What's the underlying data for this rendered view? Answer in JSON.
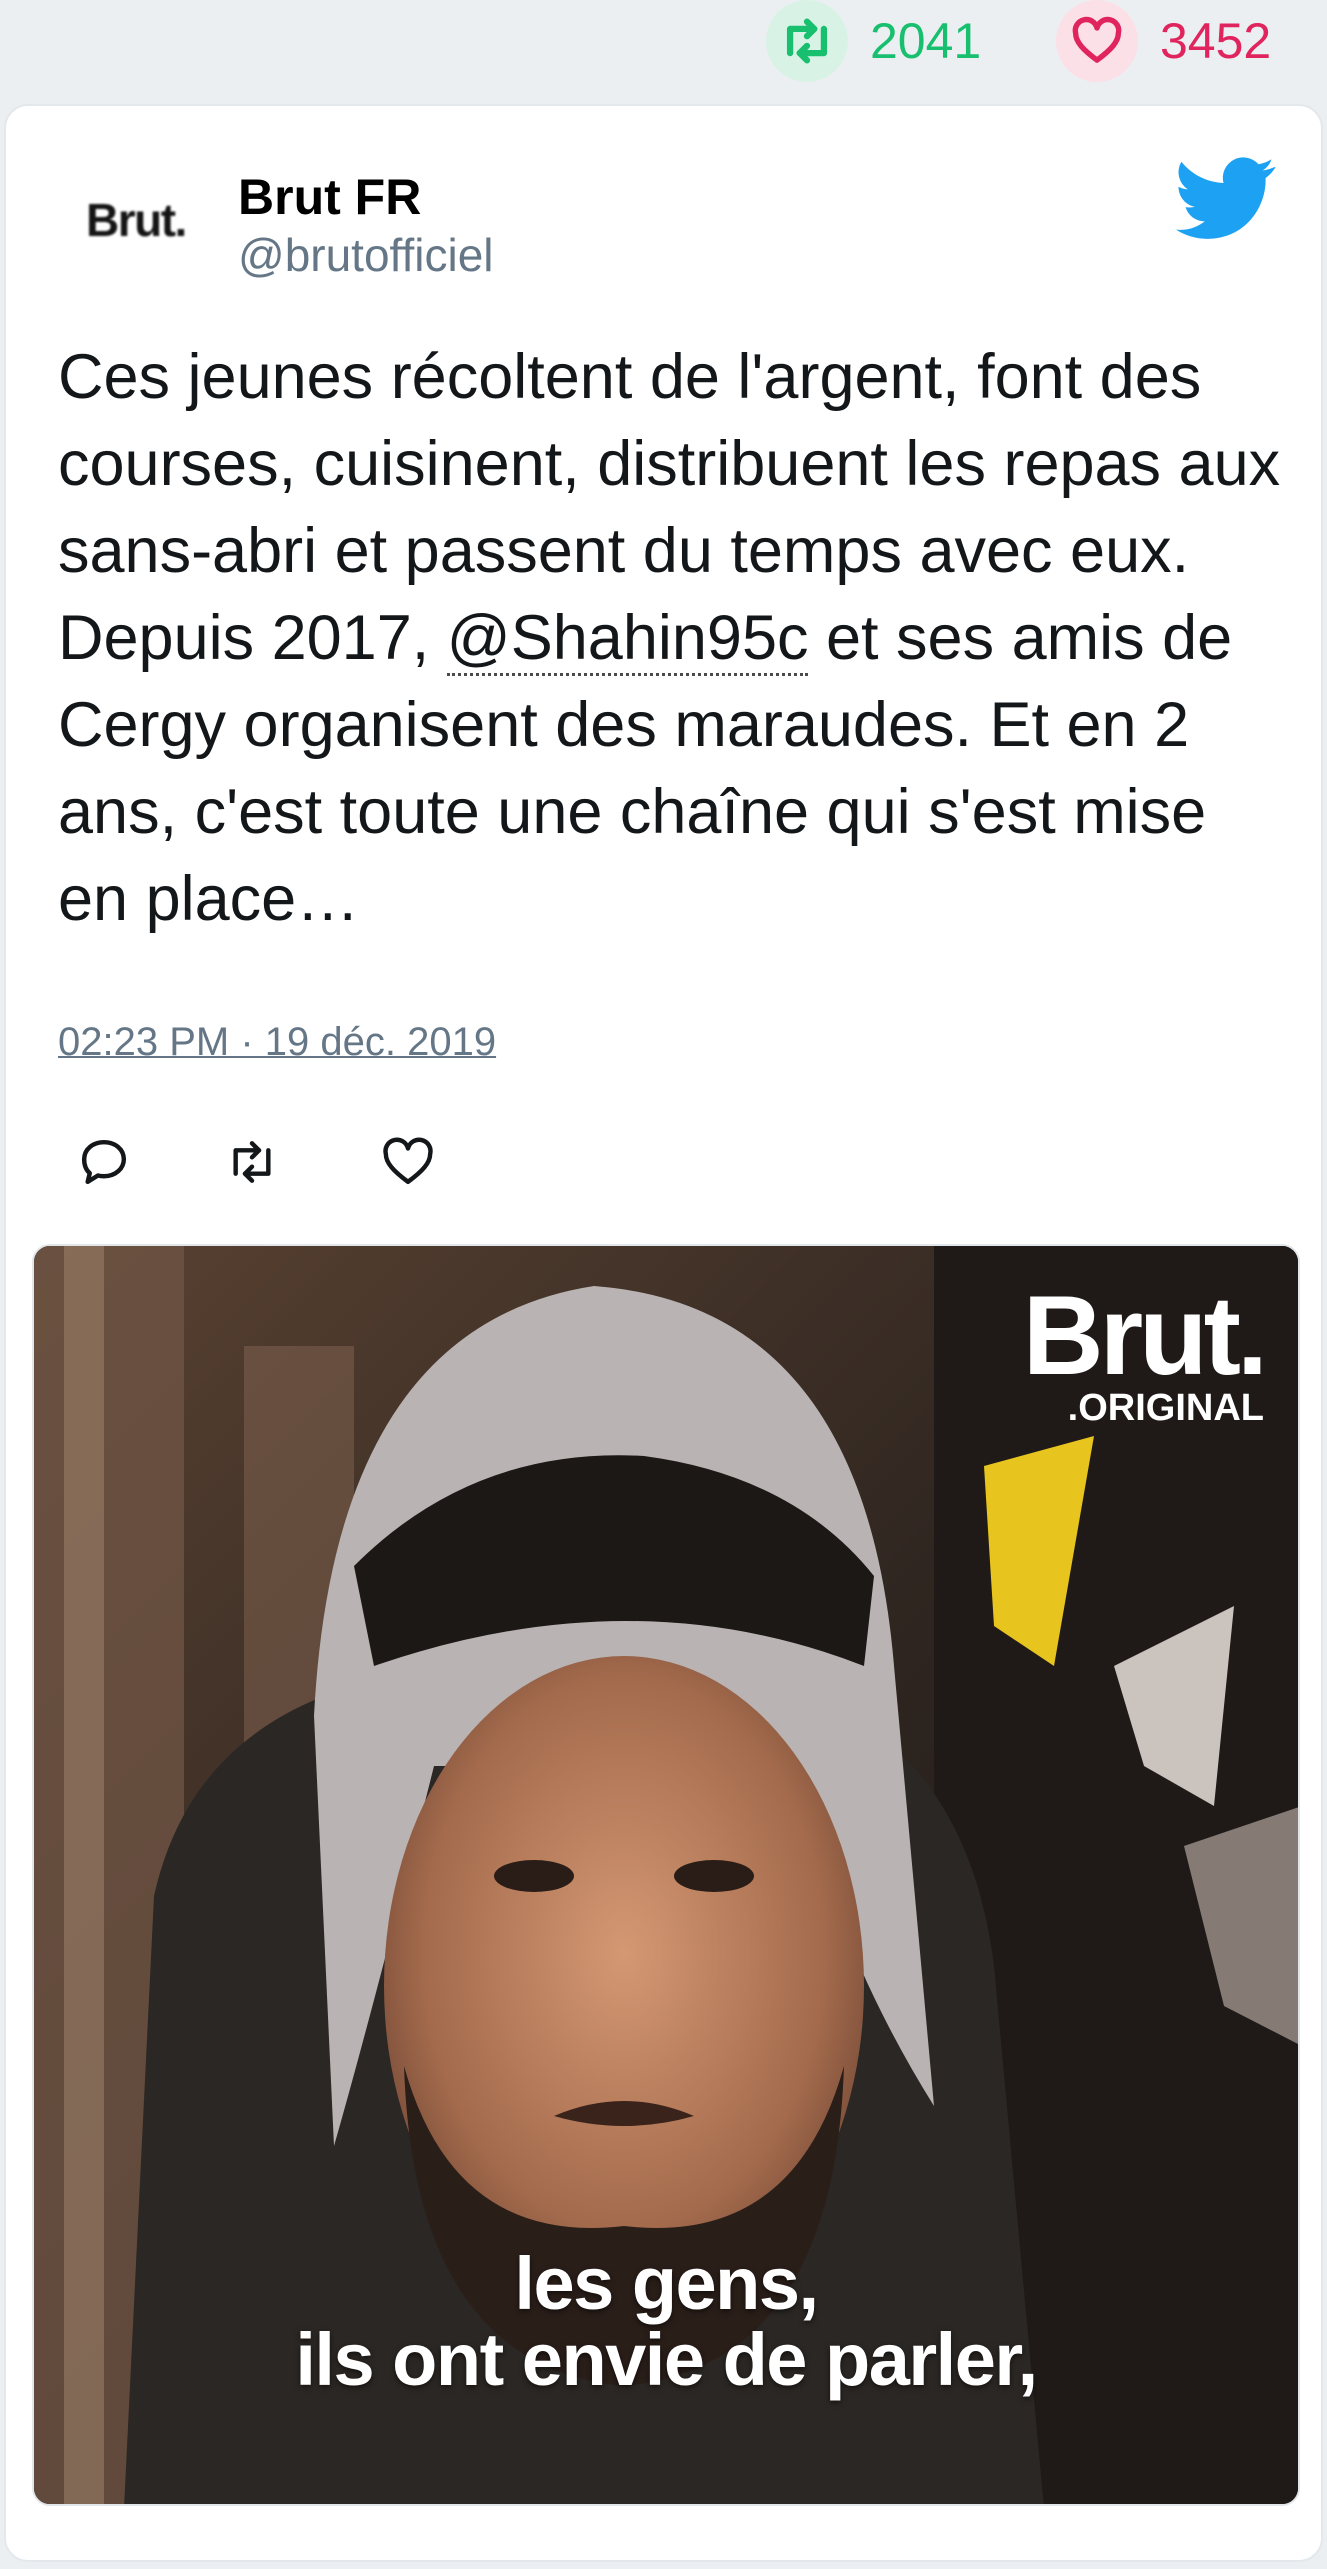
{
  "stats": {
    "retweet_count": "2041",
    "like_count": "3452"
  },
  "tweet": {
    "logo_text": "Brut.",
    "display_name": "Brut FR",
    "handle": "@brutofficiel",
    "text_before": "Ces jeunes récoltent de l'argent, font des courses, cuisinent, distribuent les repas aux sans-abri et passent du temps avec eux. Depuis 2017, ",
    "mention": "@Shahin95c",
    "text_after": " et ses amis de Cergy organisent des maraudes. Et en 2 ans, c'est toute une chaîne qui s'est mise en place…",
    "timestamp": "02:23 PM · 19 déc. 2019"
  },
  "media": {
    "brand": "Brut.",
    "brand_sub": ".ORIGINAL",
    "caption_line1": "les gens,",
    "caption_line2": "ils ont envie de parler,"
  },
  "colors": {
    "retweet": "#18bf6e",
    "like": "#e0245e",
    "twitter_blue": "#1da1f2",
    "muted": "#657786"
  },
  "icons": [
    "retweet-icon",
    "heart-icon",
    "twitter-bird-icon",
    "reply-icon"
  ]
}
